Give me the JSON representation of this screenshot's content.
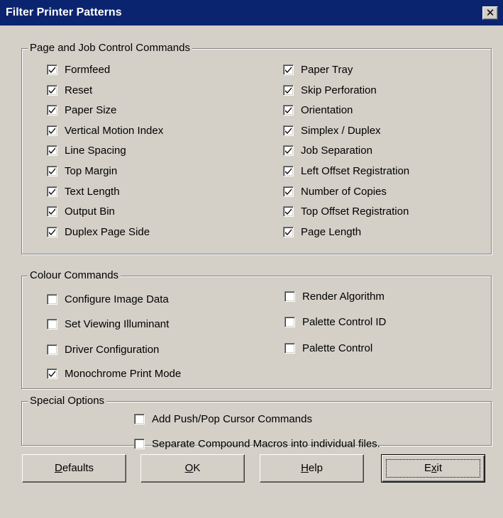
{
  "window": {
    "title": "Filter Printer Patterns",
    "close_glyph": "✕"
  },
  "page_job": {
    "label": "Page and Job Control Commands",
    "left": [
      {
        "label": "Formfeed",
        "checked": true
      },
      {
        "label": "Reset",
        "checked": true
      },
      {
        "label": "Paper Size",
        "checked": true
      },
      {
        "label": "Vertical Motion Index",
        "checked": true
      },
      {
        "label": "Line Spacing",
        "checked": true
      },
      {
        "label": "Top Margin",
        "checked": true
      },
      {
        "label": "Text Length",
        "checked": true
      },
      {
        "label": "Output Bin",
        "checked": true
      },
      {
        "label": "Duplex Page Side",
        "checked": true
      }
    ],
    "right": [
      {
        "label": "Paper Tray",
        "checked": true
      },
      {
        "label": "Skip Perforation",
        "checked": true
      },
      {
        "label": "Orientation",
        "checked": true
      },
      {
        "label": "Simplex  /  Duplex",
        "checked": true
      },
      {
        "label": "Job Separation",
        "checked": true
      },
      {
        "label": "Left Offset Registration",
        "checked": true
      },
      {
        "label": "Number of Copies",
        "checked": true
      },
      {
        "label": "Top Offset Registration",
        "checked": true
      },
      {
        "label": "Page Length",
        "checked": true
      }
    ]
  },
  "colour": {
    "label": "Colour Commands",
    "left": [
      {
        "label": "Configure Image Data",
        "checked": false
      },
      {
        "label": "Set Viewing Illuminant",
        "checked": false
      },
      {
        "label": "Driver Configuration",
        "checked": false
      },
      {
        "label": "Monochrome Print Mode",
        "checked": true
      }
    ],
    "right": [
      {
        "label": "Render Algorithm",
        "checked": false
      },
      {
        "label": "Palette Control ID",
        "checked": false
      },
      {
        "label": "Palette Control",
        "checked": false
      }
    ]
  },
  "special": {
    "label": "Special Options",
    "items": [
      {
        "label": "Add Push/Pop Cursor Commands",
        "checked": false
      },
      {
        "label": "Separate Compound Macros into individual files.",
        "checked": false
      }
    ]
  },
  "buttons": {
    "defaults": {
      "mnemonic": "D",
      "rest": "efaults"
    },
    "ok": {
      "mnemonic": "O",
      "rest": "K"
    },
    "help": {
      "mnemonic": "H",
      "rest": "elp"
    },
    "exit": {
      "pre": "E",
      "mnemonic": "x",
      "rest": "it"
    }
  },
  "colors": {
    "title_bar": "#0a2470",
    "dialog_bg": "#d4d0c8"
  }
}
